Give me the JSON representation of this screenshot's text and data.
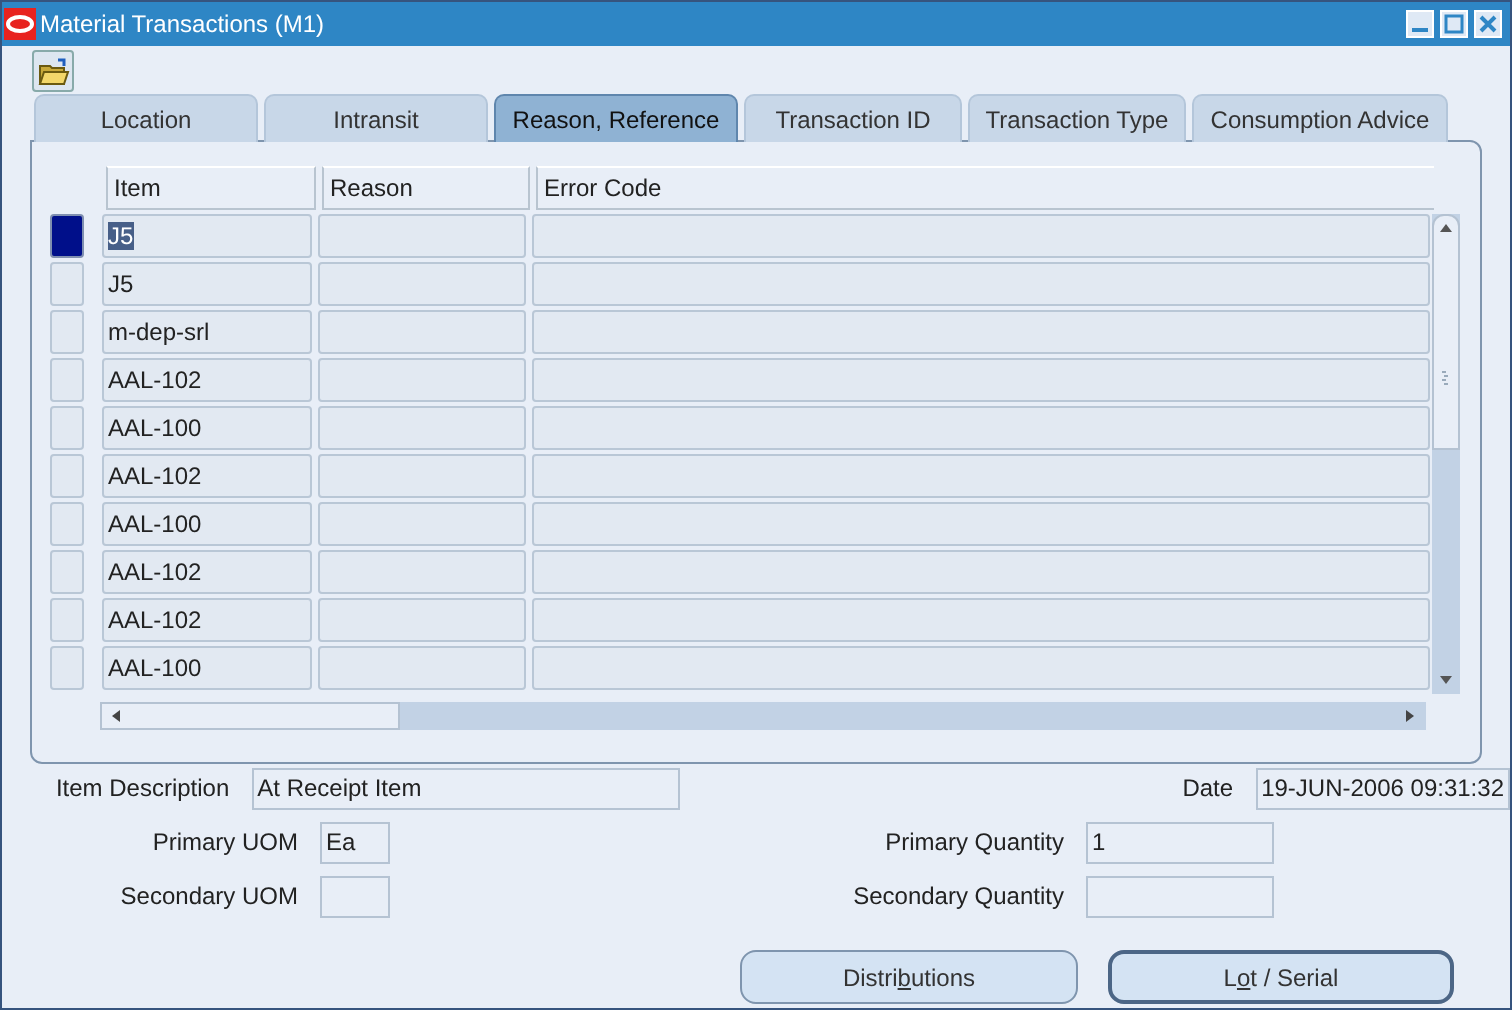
{
  "window": {
    "title": "Material Transactions (M1)"
  },
  "tabs": [
    {
      "label": "Location",
      "selected": false
    },
    {
      "label": "Intransit",
      "selected": false
    },
    {
      "label": "Reason, Reference",
      "selected": true
    },
    {
      "label": "Transaction ID",
      "selected": false
    },
    {
      "label": "Transaction Type",
      "selected": false
    },
    {
      "label": "Consumption Advice",
      "selected": false
    }
  ],
  "table": {
    "columns": [
      "Item",
      "Reason",
      "Error Code"
    ],
    "rows": [
      {
        "item": "J5",
        "selected": true
      },
      {
        "item": "J5",
        "selected": false
      },
      {
        "item": "m-dep-srl",
        "selected": false
      },
      {
        "item": "AAL-102",
        "selected": false
      },
      {
        "item": "AAL-100",
        "selected": false
      },
      {
        "item": "AAL-102",
        "selected": false
      },
      {
        "item": "AAL-100",
        "selected": false
      },
      {
        "item": "AAL-102",
        "selected": false
      },
      {
        "item": "AAL-102",
        "selected": false
      },
      {
        "item": "AAL-100",
        "selected": false
      }
    ]
  },
  "fields": {
    "item_description": {
      "label": "Item Description",
      "value": "At Receipt Item"
    },
    "date": {
      "label": "Date",
      "value": "19-JUN-2006 09:31:32"
    },
    "primary_uom": {
      "label": "Primary UOM",
      "value": "Ea"
    },
    "primary_quantity": {
      "label": "Primary Quantity",
      "value": "1"
    },
    "secondary_uom": {
      "label": "Secondary UOM"
    },
    "secondary_quantity": {
      "label": "Secondary Quantity"
    }
  },
  "buttons": [
    {
      "before": "Distri",
      "mnemonic": "b",
      "after": "utions",
      "default": false
    },
    {
      "before": "L",
      "mnemonic": "o",
      "after": "t / Serial",
      "default": true
    }
  ]
}
